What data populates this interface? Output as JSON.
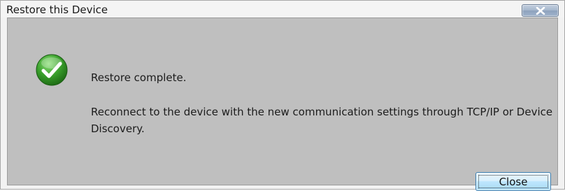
{
  "window": {
    "title": "Restore this Device",
    "close_glyph": "X"
  },
  "message": {
    "icon": "success-check-icon",
    "headline": "Restore complete.",
    "detail": "Reconnect to the device with the new communication settings through TCP/IP or Device Discovery."
  },
  "buttons": {
    "close_label": "Close"
  },
  "colors": {
    "content_background": "#bfbfbf",
    "success_green": "#3aa02c",
    "close_button_accent": "#3c7fb1"
  }
}
